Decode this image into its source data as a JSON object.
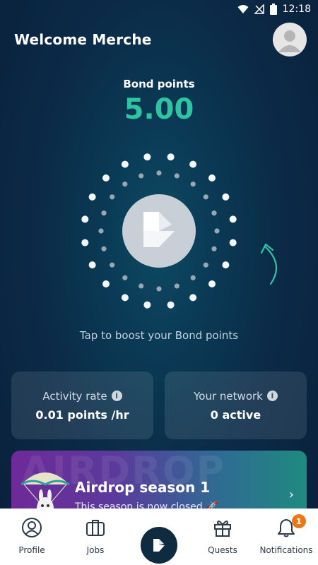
{
  "status_bar": {
    "time": "12:18"
  },
  "header": {
    "welcome": "Welcome Merche"
  },
  "bond": {
    "label": "Bond points",
    "value": "5.00",
    "hint": "Tap to boost your Bond points"
  },
  "stats": [
    {
      "title": "Activity rate",
      "value": "0.01 points /hr"
    },
    {
      "title": "Your network",
      "value": "0 active"
    }
  ],
  "airdrop": {
    "watermark": "AIRDROP",
    "title": "Airdrop season 1",
    "subtitle": "This season is now closed 🚀"
  },
  "nav": {
    "profile": "Profile",
    "jobs": "Jobs",
    "quests": "Quests",
    "notifications": "Notifications",
    "notification_count": "1"
  },
  "colors": {
    "accent": "#2ec4a2",
    "badge": "#e8791b",
    "nav_center": "#0f2b40"
  }
}
